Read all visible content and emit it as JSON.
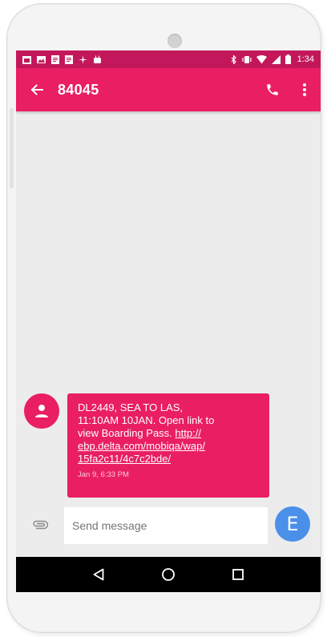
{
  "status_bar": {
    "time": "1:34",
    "left_icons": [
      "calendar-icon",
      "image-icon",
      "document-icon",
      "document-icon",
      "sparkle-icon",
      "android-icon"
    ],
    "right_icons": [
      "bluetooth-icon",
      "vibrate-icon",
      "wifi-icon",
      "signal-icon",
      "battery-icon"
    ]
  },
  "app_bar": {
    "title": "84045",
    "back_icon": "arrow-back-icon",
    "call_icon": "phone-icon",
    "menu_icon": "more-vert-icon"
  },
  "conversation": {
    "messages": [
      {
        "text": "DL2449, SEA TO LAS,\n11:10AM 10JAN. Open link to\nview Boarding Pass. ",
        "link": "http://\nebp.delta.com/mobiqa/wap/\n15fa2c11/4c7c2bde/",
        "timestamp": "Jan 9, 6:33 PM",
        "avatar_icon": "person-icon"
      }
    ]
  },
  "compose": {
    "placeholder": "Send message",
    "value": "",
    "attach_icon": "paperclip-icon",
    "send_label": "E"
  },
  "nav_bar": {
    "back_icon": "nav-back-icon",
    "home_icon": "nav-home-icon",
    "recents_icon": "nav-recents-icon"
  },
  "colors": {
    "status_bar": "#c2185b",
    "app_bar": "#e91e63",
    "bubble": "#e91e63",
    "send_button": "#4a8fe8",
    "background": "#ececec"
  }
}
